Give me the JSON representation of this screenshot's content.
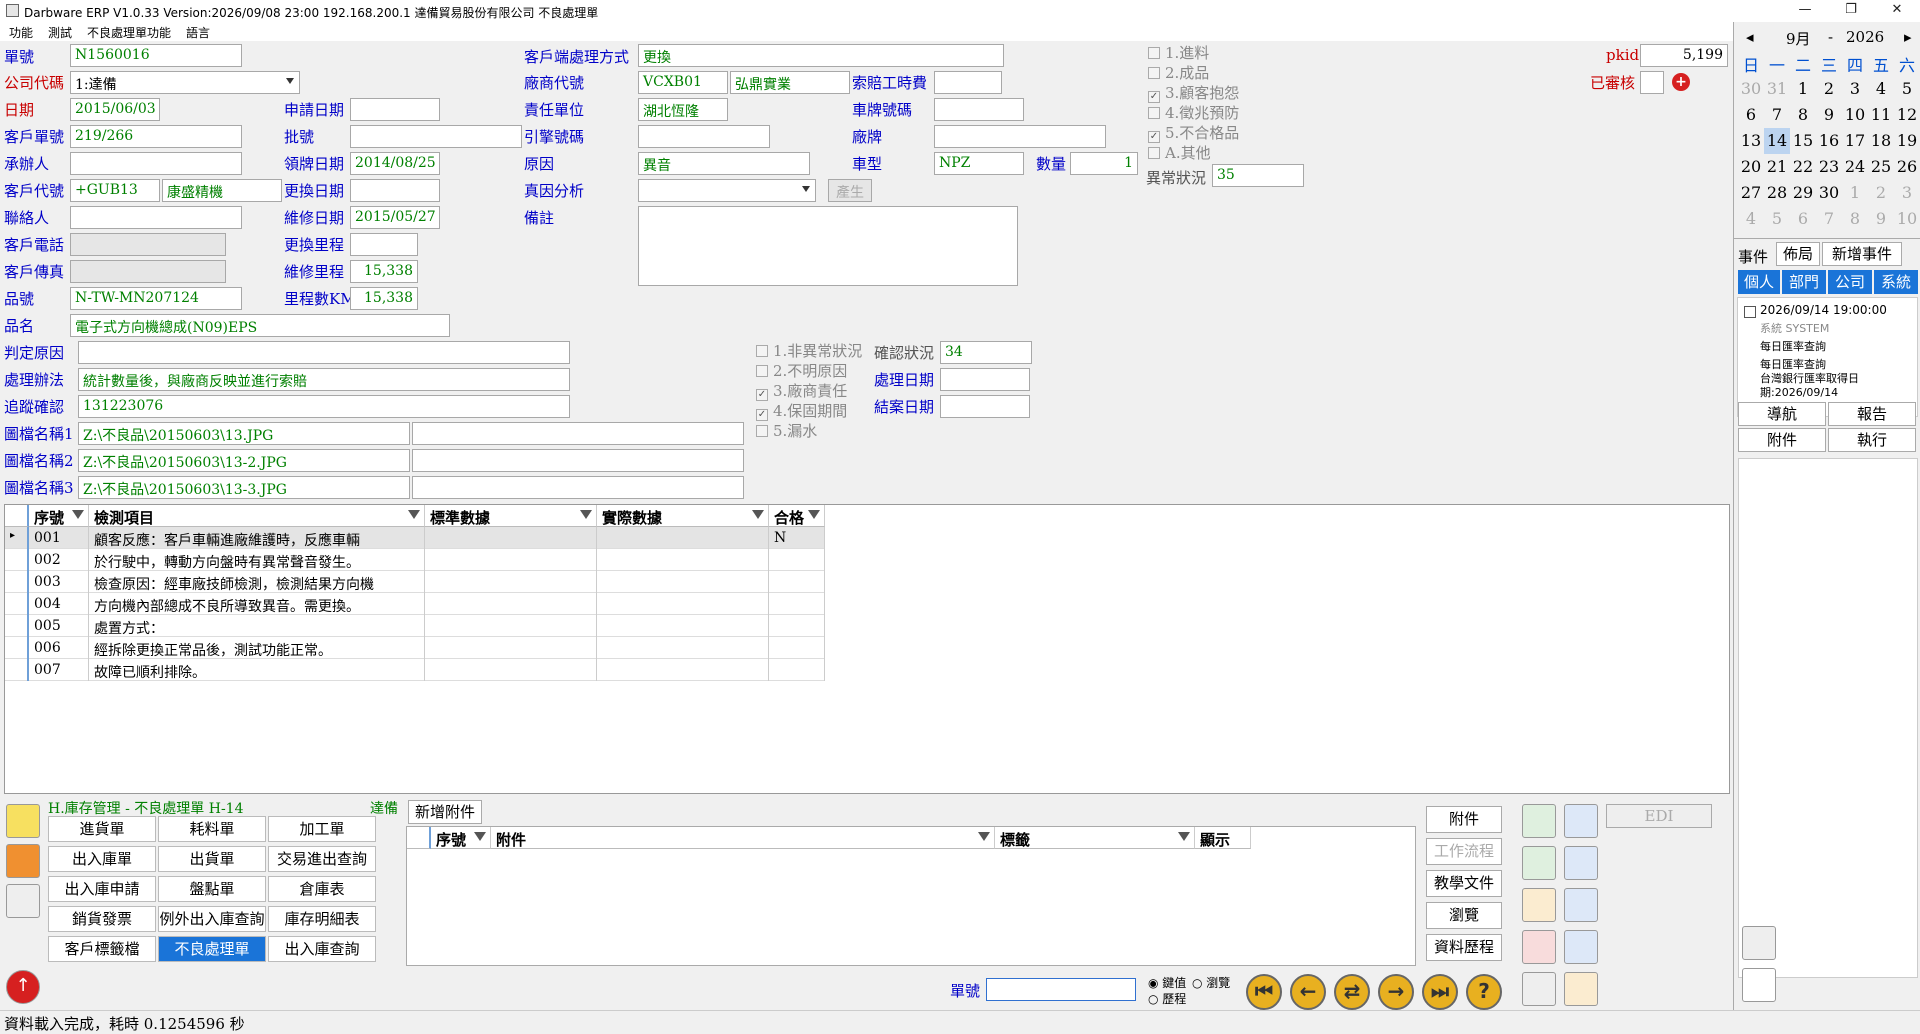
{
  "titlebar": {
    "title": "Darbware ERP V1.0.33 Version:2026/09/08 23:00    192.168.200.1 達備貿易股份有限公司 不良處理單",
    "min": "—",
    "max": "❐",
    "close": "✕"
  },
  "menu": [
    "功能",
    "測試",
    "不良處理單功能",
    "語言"
  ],
  "form": {
    "labels": {
      "dan": "單號",
      "company": "公司代碼",
      "date": "日期",
      "custorder": "客戶單號",
      "handler": "承辦人",
      "custcode": "客戶代號",
      "contact": "聯絡人",
      "custphone": "客戶電話",
      "custfax": "客戶傳真",
      "partno": "品號",
      "partname": "品名",
      "judge": "判定原因",
      "method": "處理辦法",
      "track": "追蹤確認",
      "img1": "圖檔名稱1",
      "img2": "圖檔名稱2",
      "img3": "圖檔名稱3",
      "applydate": "申請日期",
      "batch": "批號",
      "licdate": "領牌日期",
      "changedate": "更換日期",
      "repairdate": "維修日期",
      "changemile": "更換里程",
      "repairmile": "維修里程",
      "mileagekm": "里程數KM",
      "custway": "客戶端處理方式",
      "vendor": "廠商代號",
      "resp": "責任單位",
      "engine": "引擎號碼",
      "reason": "原因",
      "truecause": "真因分析",
      "remark": "備註",
      "claim": "索賠工時費",
      "plate": "車牌號碼",
      "brand": "廠牌",
      "cartype": "車型",
      "qty": "數量",
      "abnormal": "異常狀況",
      "confirm": "確認狀況",
      "procdate": "處理日期",
      "closedate": "結案日期",
      "pkid": "pkid",
      "audited": "已審核",
      "gen": "產生"
    },
    "values": {
      "dan": "N1560016",
      "company": "1:達備",
      "date": "2015/06/03",
      "custorder": "219/266",
      "custcode": "+GUB13",
      "custname": "康盛精機",
      "partno": "N-TW-MN207124",
      "partname": "電子式方向機總成(N09)EPS",
      "method": "統計數量後，與廠商反映並進行索賠",
      "track": "131223076",
      "img1": "Z:\\不良品\\20150603\\13.JPG",
      "img2": "Z:\\不良品\\20150603\\13-2.JPG",
      "img3": "Z:\\不良品\\20150603\\13-3.JPG",
      "licdate": "2014/08/25",
      "repairdate": "2015/05/27",
      "repairmile": "15,338",
      "mileagekm": "15,338",
      "custway": "更換",
      "vendor": "VCXB01",
      "vendorname": "弘鼎實業",
      "resp": "湖北恆隆",
      "reason": "異音",
      "cartype": "NPZ",
      "qty": "1",
      "abnormal": "35",
      "confirm": "34",
      "pkid": "5,199"
    },
    "checks1": [
      {
        "label": "1.進料",
        "on": false
      },
      {
        "label": "2.成品",
        "on": false
      },
      {
        "label": "3.顧客抱怨",
        "on": true
      },
      {
        "label": "4.徵兆預防",
        "on": false
      },
      {
        "label": "5.不合格品",
        "on": true
      },
      {
        "label": "A.其他",
        "on": false
      }
    ],
    "checks2": [
      {
        "label": "1.非異常狀況",
        "on": false
      },
      {
        "label": "2.不明原因",
        "on": false
      },
      {
        "label": "3.廠商責任",
        "on": true
      },
      {
        "label": "4.保固期間",
        "on": true
      },
      {
        "label": "5.漏水",
        "on": false
      }
    ]
  },
  "grid": {
    "headers": [
      "序號",
      "檢測項目",
      "標準數據",
      "實際數據",
      "合格"
    ],
    "rows": [
      {
        "no": "001",
        "item": "顧客反應：客戶車輛進廠維護時，反應車輛",
        "std": "",
        "act": "",
        "ok": "N"
      },
      {
        "no": "002",
        "item": "於行駛中，轉動方向盤時有異常聲音發生。",
        "std": "",
        "act": "",
        "ok": ""
      },
      {
        "no": "003",
        "item": "檢查原因：經車廠技師檢測，檢測結果方向機",
        "std": "",
        "act": "",
        "ok": ""
      },
      {
        "no": "004",
        "item": "方向機內部總成不良所導致異音。需更換。",
        "std": "",
        "act": "",
        "ok": ""
      },
      {
        "no": "005",
        "item": "處置方式：",
        "std": "",
        "act": "",
        "ok": ""
      },
      {
        "no": "006",
        "item": "經拆除更換正常品後，測試功能正常。",
        "std": "",
        "act": "",
        "ok": ""
      },
      {
        "no": "007",
        "item": "故障已順利排除。",
        "std": "",
        "act": "",
        "ok": ""
      }
    ]
  },
  "calendar": {
    "month": "9月",
    "sep": "-",
    "year": "2026",
    "dow": [
      "日",
      "一",
      "二",
      "三",
      "四",
      "五",
      "六"
    ],
    "weeks": [
      [
        "30",
        "31",
        "1",
        "2",
        "3",
        "4",
        "5"
      ],
      [
        "6",
        "7",
        "8",
        "9",
        "10",
        "11",
        "12"
      ],
      [
        "13",
        "14",
        "15",
        "16",
        "17",
        "18",
        "19"
      ],
      [
        "20",
        "21",
        "22",
        "23",
        "24",
        "25",
        "26"
      ],
      [
        "27",
        "28",
        "29",
        "30",
        "1",
        "2",
        "3"
      ],
      [
        "4",
        "5",
        "6",
        "7",
        "8",
        "9",
        "10"
      ]
    ],
    "tabs": [
      "事件",
      "佈局",
      "新增事件"
    ],
    "scope": [
      "個人",
      "部門",
      "公司",
      "系統"
    ],
    "event": {
      "time": "2026/09/14 19:00:00",
      "who": "系統  SYSTEM",
      "l1": "每日匯率查詢",
      "l2": "每日匯率查詢",
      "l3": "台灣銀行匯率取得日",
      "l4": "期:2026/09/14"
    },
    "actions": [
      "導航",
      "報告",
      "附件",
      "執行"
    ]
  },
  "modules": {
    "title": "H.庫存管理 - 不良處理單  H-14",
    "company": "達備",
    "items": [
      "進貨單",
      "耗料單",
      "加工單",
      "出入庫單",
      "出貨單",
      "交易進出查詢",
      "出入庫申請",
      "盤點單",
      "倉庫表",
      "銷貨發票",
      "例外出入庫查詢",
      "庫存明細表",
      "客戶標籤檔",
      "不良處理單",
      "出入庫查詢"
    ]
  },
  "attach": {
    "add": "新增附件",
    "headers": [
      "序號",
      "附件",
      "標籤",
      "顯示"
    ]
  },
  "side": {
    "buttons": [
      "附件",
      "工作流程",
      "教學文件",
      "瀏覽",
      "資料歷程"
    ],
    "edi": "EDI"
  },
  "nav": {
    "danlabel": "單號",
    "radio1": "鍵值",
    "radio2": "瀏覽",
    "radio3": "歷程"
  },
  "status": "資料載入完成，耗時 0.1254596 秒"
}
